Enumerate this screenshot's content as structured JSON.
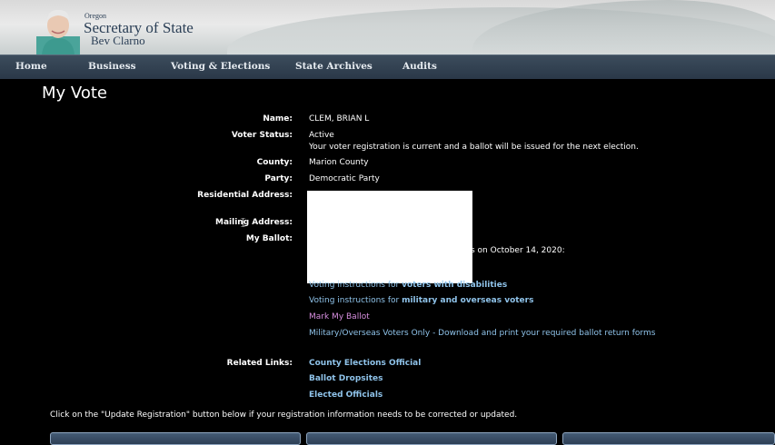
{
  "header": {
    "agency_small": "Oregon",
    "agency_main": "Secretary of State",
    "official_name": "Bev Clarno"
  },
  "nav": [
    "Home",
    "Business",
    "Voting & Elections",
    "State Archives",
    "Audits"
  ],
  "page_title": "My Vote",
  "voter": {
    "name_label": "Name:",
    "name": "CLEM, BRIAN L",
    "status_label": "Voter Status:",
    "status": "Active",
    "status_note": "Your voter registration is current and a ballot will be issued for the next election.",
    "county_label": "County:",
    "county": "Marion County",
    "party_label": "Party:",
    "party": "Democratic Party",
    "residential_label": "Residential Address:",
    "mailing_label": "Mailing Address:",
    "ballot_label": "My Ballot:",
    "ballot_partial_text": "s on October 14, 2020:"
  },
  "ballot_links": {
    "disabilities_prefix": "Voting instructions for ",
    "disabilities_bold": "voters with disabilities",
    "military_prefix": "Voting instructions for ",
    "military_bold": "military and overseas voters",
    "mark_ballot": "Mark My Ballot",
    "military_forms": "Military/Overseas Voters Only - Download and print your required ballot return forms"
  },
  "related": {
    "label": "Related Links:",
    "links": [
      "County Elections Official",
      "Ballot Dropsites",
      "Elected Officials"
    ]
  },
  "footnote": "Click on the \"Update Registration\" button below if your registration information needs to be corrected or updated.",
  "colors": {
    "background": "#000000",
    "link": "#8fc3ea",
    "visited_link": "#d88fe0",
    "nav_bar": "#34444f"
  }
}
